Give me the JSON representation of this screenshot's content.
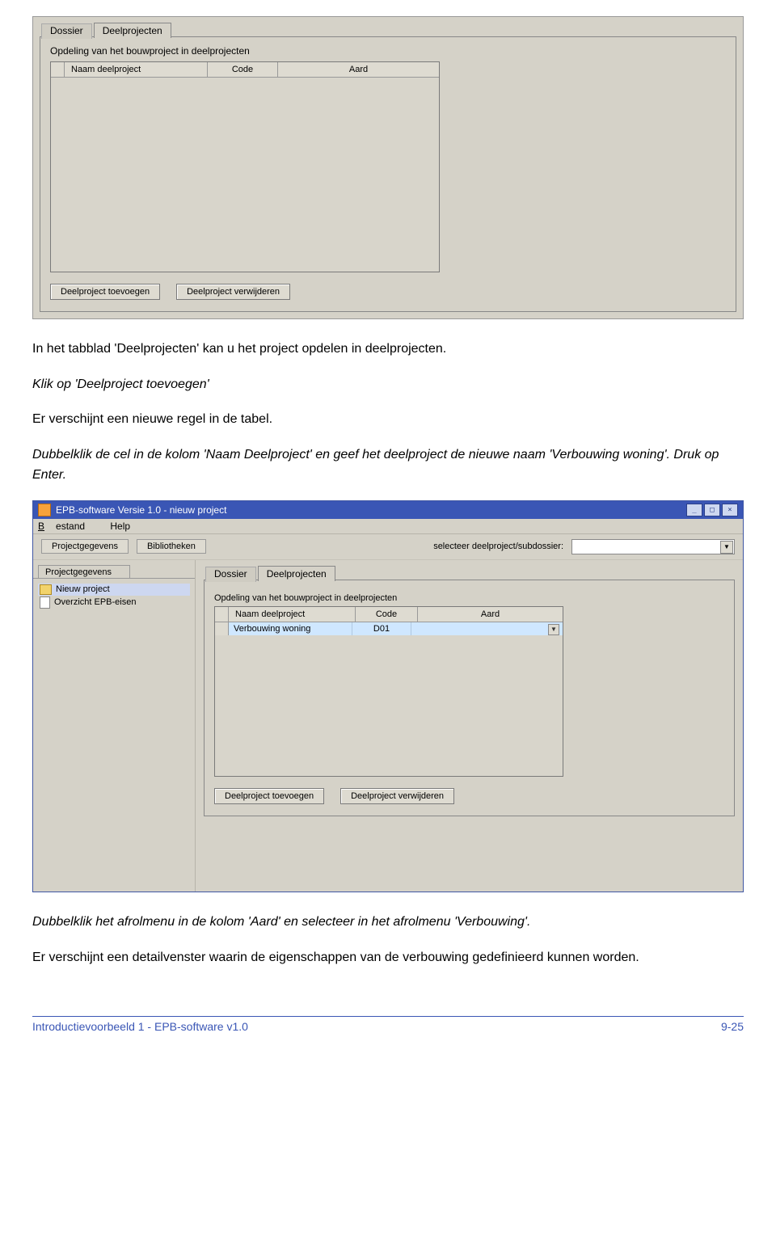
{
  "screenshot1": {
    "tabs": [
      "Dossier",
      "Deelprojecten"
    ],
    "group_label": "Opdeling van het bouwproject in deelprojecten",
    "columns": [
      "Naam deelproject",
      "Code",
      "Aard"
    ],
    "buttons": {
      "add": "Deelproject toevoegen",
      "remove": "Deelproject verwijderen"
    }
  },
  "text": {
    "p1": "In het tabblad 'Deelprojecten' kan u het project opdelen in deelprojecten.",
    "p2": "Klik op 'Deelproject toevoegen'",
    "p3": "Er verschijnt een nieuwe regel in de tabel.",
    "p4": "Dubbelklik de cel in de kolom 'Naam Deelproject' en geef het deelproject de nieuwe naam 'Verbouwing woning'. Druk op Enter.",
    "p5": "Dubbelklik het afrolmenu in de kolom 'Aard' en selecteer in het afrolmenu 'Verbouwing'.",
    "p6": "Er verschijnt een detailvenster waarin de eigenschappen van de verbouwing gedefinieerd kunnen worden."
  },
  "window": {
    "title": "EPB-software Versie 1.0 - nieuw project",
    "menu": {
      "bestand": "Bestand",
      "help": "Help"
    },
    "toolbar": {
      "btn1": "Projectgegevens",
      "btn2": "Bibliotheken",
      "label": "selecteer deelproject/subdossier:"
    },
    "sidebar": {
      "tab": "Projectgegevens",
      "item1": "Nieuw project",
      "item2": "Overzicht EPB-eisen"
    },
    "main": {
      "tabs": [
        "Dossier",
        "Deelprojecten"
      ],
      "group_label": "Opdeling van het bouwproject in deelprojecten",
      "columns": [
        "Naam deelproject",
        "Code",
        "Aard"
      ],
      "row": {
        "name": "Verbouwing woning",
        "code": "D01",
        "aard": ""
      },
      "buttons": {
        "add": "Deelproject toevoegen",
        "remove": "Deelproject verwijderen"
      }
    }
  },
  "footer": {
    "left": "Introductievoorbeeld 1 - EPB-software v1.0",
    "right": "9-25"
  }
}
